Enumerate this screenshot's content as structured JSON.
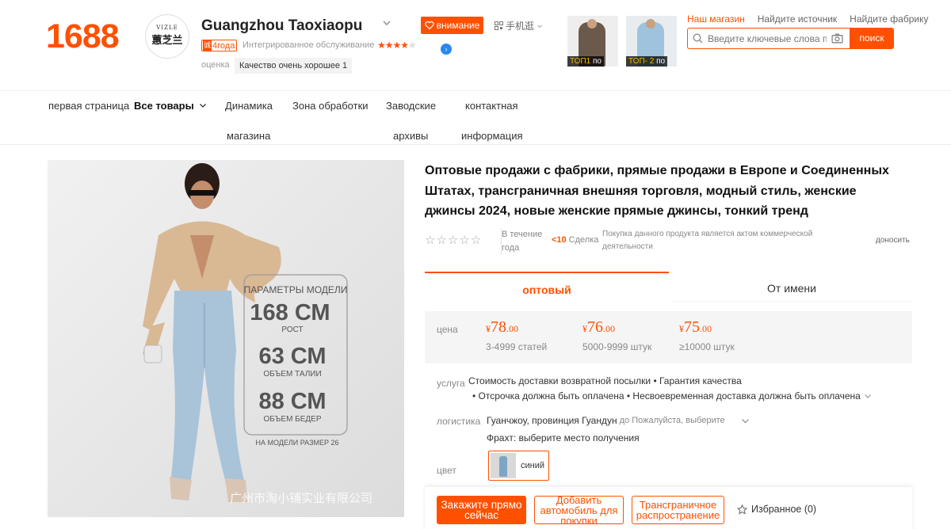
{
  "header": {
    "logo": "1688",
    "shop": {
      "avatar_small": "VIZLE",
      "avatar_big": "蕙芝兰",
      "name": "Guangzhou Taoxiaopu",
      "follow_label": "внимание",
      "mobile_label": "手机逛",
      "years_icon": "诚",
      "years_label": "4года",
      "service_label": "Интегрированное обслуживание",
      "service_stars": 4,
      "rating_label": "оценка",
      "rating_value": "Качество очень хорошее 1"
    },
    "promo_thumbs": [
      {
        "rank": "ТОП1",
        "suffix": "по"
      },
      {
        "rank": "ТОП- 2",
        "suffix": "по"
      }
    ],
    "top_links": [
      "Наш магазин",
      "Найдите источник",
      "Найдите фабрику"
    ],
    "search": {
      "placeholder": "Введите ключевые слова про",
      "button": "поиск"
    }
  },
  "nav": {
    "home": "первая страница",
    "all_goods": "Все товары",
    "dynamics_line1": "Динамика",
    "dynamics_line2": "магазина",
    "processing": "Зона обработки",
    "factory_line1": "Заводские",
    "factory_line2": "архивы",
    "contact_line1": "контактная",
    "contact_line2": "информация"
  },
  "product": {
    "image_alt": "Модель в светлых джинсах",
    "title": "Оптовые продажи с фабрики, прямые продажи в Европе и Соединенных Штатах, трансграничная внешняя торговля, модный стиль, женские джинсы 2024, новые женские прямые джинсы, тонкий тренд",
    "period": "В течение года",
    "deals_count": "<10",
    "deals_label": "Сделка",
    "notice": "Покупка данного продукта является актом коммерческой деятельности",
    "report": "доносить",
    "tabs": [
      "оптовый",
      "От имени"
    ],
    "price_label": "цена",
    "prices": [
      {
        "currency": "¥",
        "int": "78",
        "dec": ".00",
        "qty": "3-4999 статей"
      },
      {
        "currency": "¥",
        "int": "76",
        "dec": ".00",
        "qty": "5000-9999 штук"
      },
      {
        "currency": "¥",
        "int": "75",
        "dec": ".00",
        "qty": "≥10000 штук"
      }
    ],
    "service_label": "услуга",
    "service_line1": "Стоимость доставки возвратной посылки • Гарантия качества",
    "service_line2": "• Отсрочка должна быть оплачена • Несвоевременная доставка должна быть оплачена",
    "logistics_label": "логистика",
    "logistics_from": "Гуанчжоу, провинция Гуандун",
    "logistics_to": "до Пожалуйста, выберите",
    "freight": "Фрахт: выберите место получения",
    "color_label": "цвет",
    "color_name": "синий",
    "buttons": {
      "order_now": "Закажите прямо сейчас",
      "add_to_cart": "Добавить автомобиль для покупки",
      "crossborder": "Трансграничное распространение",
      "favorite": "Избранное (0)"
    }
  },
  "poster": {
    "params_title": "ПАРАМЕТРЫ МОДЕЛИ",
    "height": "168 СМ",
    "height_label": "РОСТ",
    "waist": "63 СМ",
    "waist_label": "ОБЪЕМ ТАЛИИ",
    "hip": "88 СМ",
    "hip_label": "ОБЪЕМ БЕДЕР",
    "size_note": "НА МОДЕЛИ РАЗМЕР 26",
    "watermark": "广州市淘小铺实业有限公司"
  },
  "colors": {
    "accent": "#ff5000",
    "muted": "#888888",
    "panel": "#f5f5f5"
  }
}
